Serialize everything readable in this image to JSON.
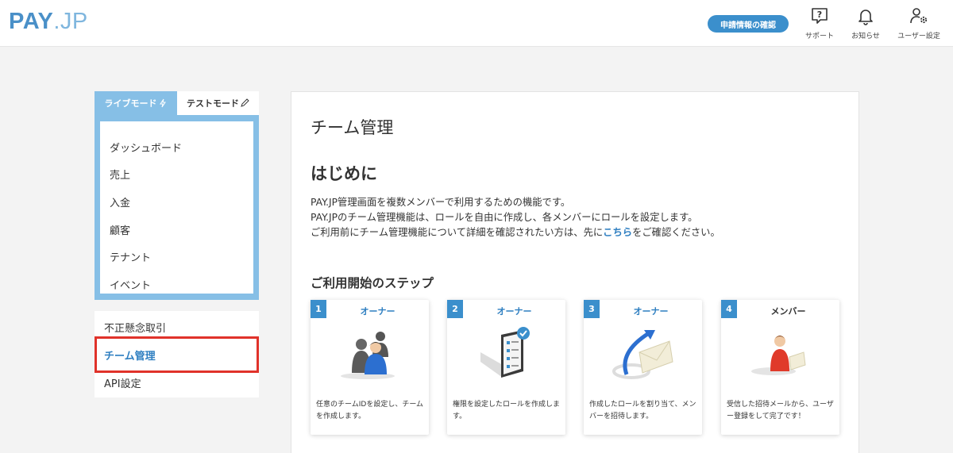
{
  "header": {
    "logo_main": "PAY",
    "logo_sub": ".JP",
    "apply_button": "申請情報の確認",
    "support_label": "サポート",
    "notice_label": "お知らせ",
    "user_settings_label": "ユーザー設定"
  },
  "sidebar": {
    "live_mode": "ライブモード",
    "test_mode": "テストモード",
    "items": [
      "ダッシュボード",
      "売上",
      "入金",
      "顧客",
      "テナント",
      "イベント"
    ],
    "fraud": "不正懸念取引",
    "team": "チーム管理",
    "api": "API設定"
  },
  "main": {
    "title": "チーム管理",
    "section_title": "はじめに",
    "intro_line1": "PAY.JP管理画面を複数メンバーで利用するための機能です。",
    "intro_line2": "PAY.JPのチーム管理機能は、ロールを自由に作成し、各メンバーにロールを設定します。",
    "intro_line3_pre": "ご利用前にチーム管理機能について詳細を確認されたい方は、先に",
    "intro_link": "こちら",
    "intro_line3_post": "をご確認ください。",
    "steps_title": "ご利用開始のステップ",
    "steps": [
      {
        "num": "1",
        "role": "オーナー",
        "desc": "任意のチームIDを設定し、チームを作成します。"
      },
      {
        "num": "2",
        "role": "オーナー",
        "desc": "権限を設定したロールを作成します。"
      },
      {
        "num": "3",
        "role": "オーナー",
        "desc": "作成したロールを割り当て、メンバーを招待します。"
      },
      {
        "num": "4",
        "role": "メンバー",
        "desc": "受信した招待メールから、ユーザー登録をして完了です！"
      }
    ]
  },
  "colors": {
    "accent": "#3b8fcc",
    "sidebar_frame": "#86bfe6",
    "highlight": "#e0322a"
  }
}
